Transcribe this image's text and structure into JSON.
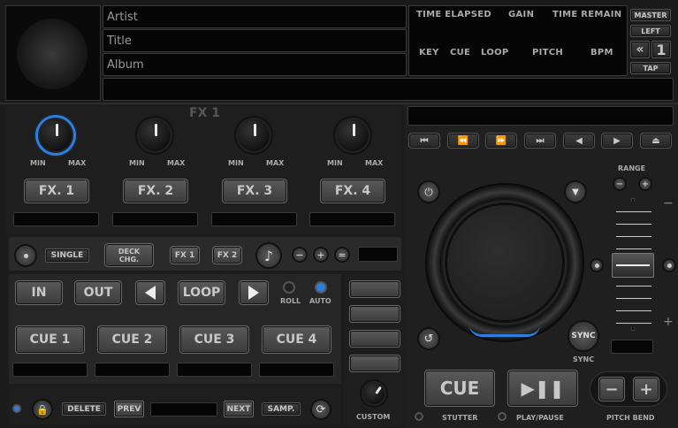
{
  "track": {
    "artist": "Artist",
    "title": "Title",
    "album": "Album"
  },
  "info": {
    "time_elapsed": "TIME ELAPSED",
    "gain": "GAIN",
    "time_remain": "TIME REMAIN",
    "key": "KEY",
    "cue": "CUE",
    "loop": "LOOP",
    "pitch": "PITCH",
    "bpm": "BPM"
  },
  "deckctl": {
    "master": "MASTER",
    "left": "LEFT",
    "deck_num": "1",
    "tap": "TAP"
  },
  "fx": {
    "title": "FX 1",
    "min": "MIN",
    "max": "MAX",
    "buttons": [
      "FX. 1",
      "FX. 2",
      "FX. 3",
      "FX. 4"
    ]
  },
  "fxrow": {
    "single": "SINGLE",
    "deck_chg": "DECK CHG.",
    "fx1": "FX 1",
    "fx2": "FX 2"
  },
  "loop": {
    "in": "IN",
    "out": "OUT",
    "loop": "LOOP",
    "roll": "ROLL",
    "auto": "AUTO"
  },
  "cues": [
    "CUE 1",
    "CUE 2",
    "CUE 3",
    "CUE 4"
  ],
  "bottom": {
    "delete": "DELETE",
    "prev": "PREV",
    "next": "NEXT",
    "samp": "SAMP."
  },
  "right": {
    "range": "RANGE",
    "sync": "SYNC",
    "sync_lbl": "SYNC",
    "cue": "CUE",
    "custom": "CUSTOM",
    "stutter": "STUTTER",
    "play_pause": "PLAY/PAUSE",
    "pitch_bend": "PITCH BEND"
  },
  "colors": {
    "accent": "#2a7fe0"
  }
}
